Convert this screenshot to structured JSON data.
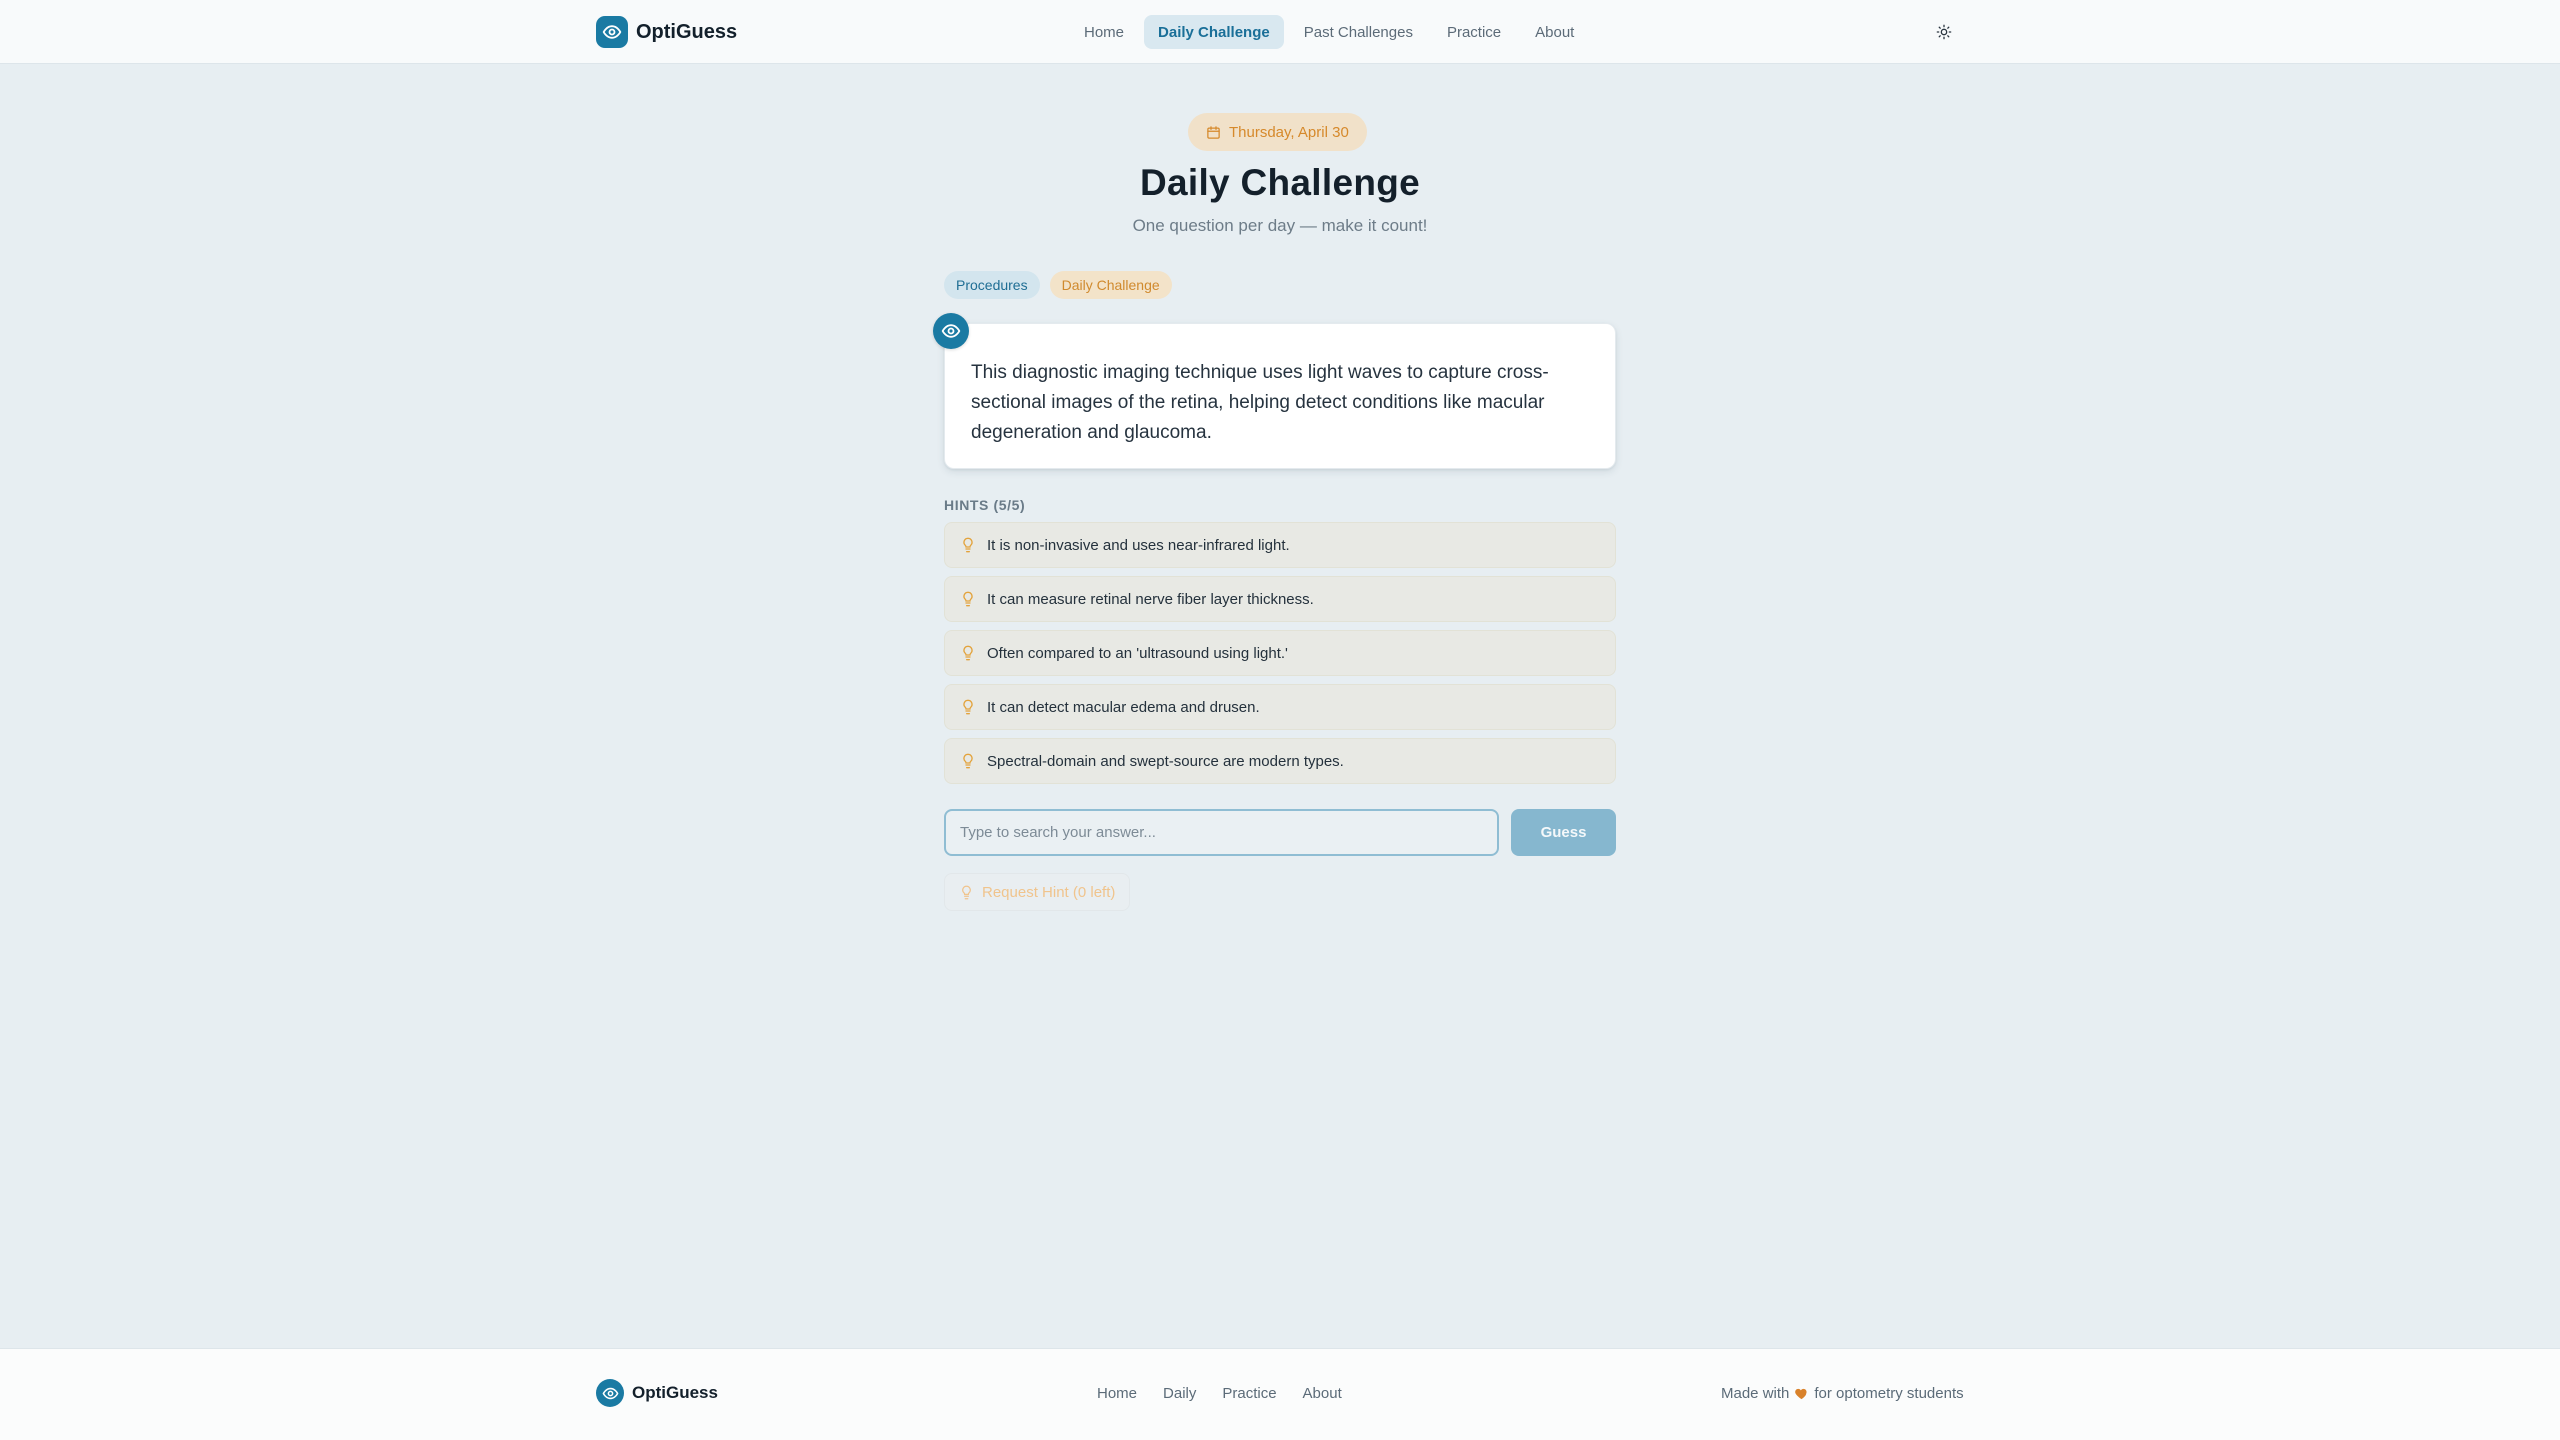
{
  "app": {
    "name": "OptiGuess",
    "accent": "#1a7aa3"
  },
  "nav": {
    "items": [
      {
        "label": "Home",
        "active": false
      },
      {
        "label": "Daily Challenge",
        "active": true
      },
      {
        "label": "Past Challenges",
        "active": false
      },
      {
        "label": "Practice",
        "active": false
      },
      {
        "label": "About",
        "active": false
      }
    ],
    "theme_icon": "sun-icon"
  },
  "challenge": {
    "date": "Thursday, April 30",
    "title": "Daily Challenge",
    "subtitle": "One question per day — make it count!",
    "tags": [
      "Procedures",
      "Daily Challenge"
    ],
    "question": "This diagnostic imaging technique uses light waves to capture cross-sectional images of the retina, helping detect conditions like macular degeneration and glaucoma."
  },
  "hints": {
    "heading": "HINTS (5/5)",
    "items": [
      "It is non-invasive and uses near-infrared light.",
      "It can measure retinal nerve fiber layer thickness.",
      "Often compared to an 'ultrasound using light.'",
      "It can detect macular edema and drusen.",
      "Spectral-domain and swept-source are modern types."
    ]
  },
  "answer": {
    "placeholder": "Type to search your answer...",
    "value": "",
    "guess_label": "Guess",
    "request_hint_label": "Request Hint (0 left)"
  },
  "footer": {
    "brand": "OptiGuess",
    "links": [
      "Home",
      "Daily",
      "Practice",
      "About"
    ],
    "credit_before": "Made with",
    "credit_after": "for optometry students",
    "heart_color": "#d9822b"
  }
}
